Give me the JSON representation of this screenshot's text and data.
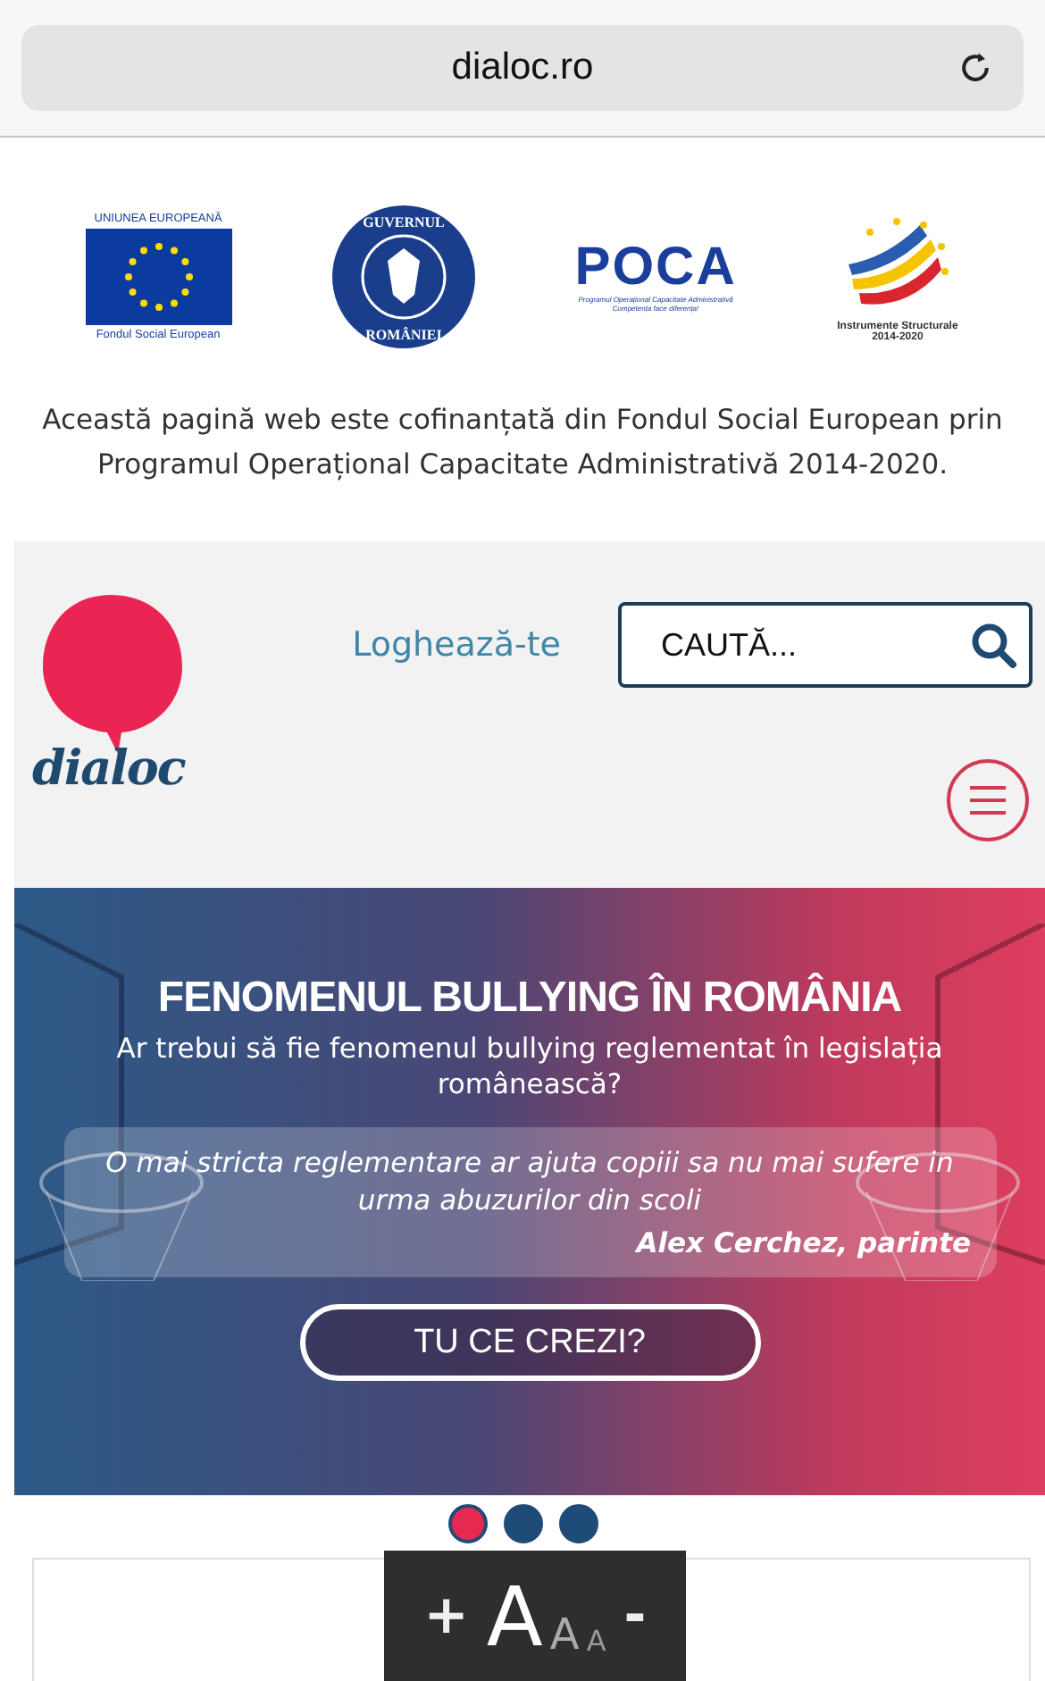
{
  "browser": {
    "url": "dialoc.ro"
  },
  "sponsors": {
    "eu_logo": {
      "top": "UNIUNEA EUROPEANĂ",
      "bottom": "Fondul Social European"
    },
    "gov_logo": {
      "top": "GUVERNUL",
      "bottom": "ROMÂNIEI"
    },
    "poca_logo": {
      "name": "POCA",
      "line_1": "Programul Operațional Capacitate Administrativă",
      "line_2": "Competența face diferența!"
    },
    "is_logo": {
      "line_1": "Instrumente Structurale",
      "line_2": "2014-2020"
    },
    "notice": "Această pagină web este cofinanțată din Fondul Social European prin Programul Operațional Capacitate Administrativă 2014-2020."
  },
  "header": {
    "logo_text": "dialoc",
    "login": "Loghează-te",
    "search": {
      "placeholder": "CAUTĂ..."
    }
  },
  "banner": {
    "title": "FENOMENUL BULLYING ÎN ROMÂNIA",
    "question": "Ar trebui să fie fenomenul bullying reglementat în legislația românească?",
    "quote": "O mai stricta reglementare ar ajuta copiii sa nu mai sufere in urma abuzurilor din scoli",
    "author": "Alex Cerchez, parinte",
    "button": "TU CE CREZI?"
  },
  "slides": [
    {
      "selected": true
    },
    {
      "selected": false
    },
    {
      "selected": false
    }
  ],
  "font_size_widget": {
    "plus": "+",
    "letters": [
      "A",
      "A",
      "A"
    ],
    "minus": "-"
  }
}
